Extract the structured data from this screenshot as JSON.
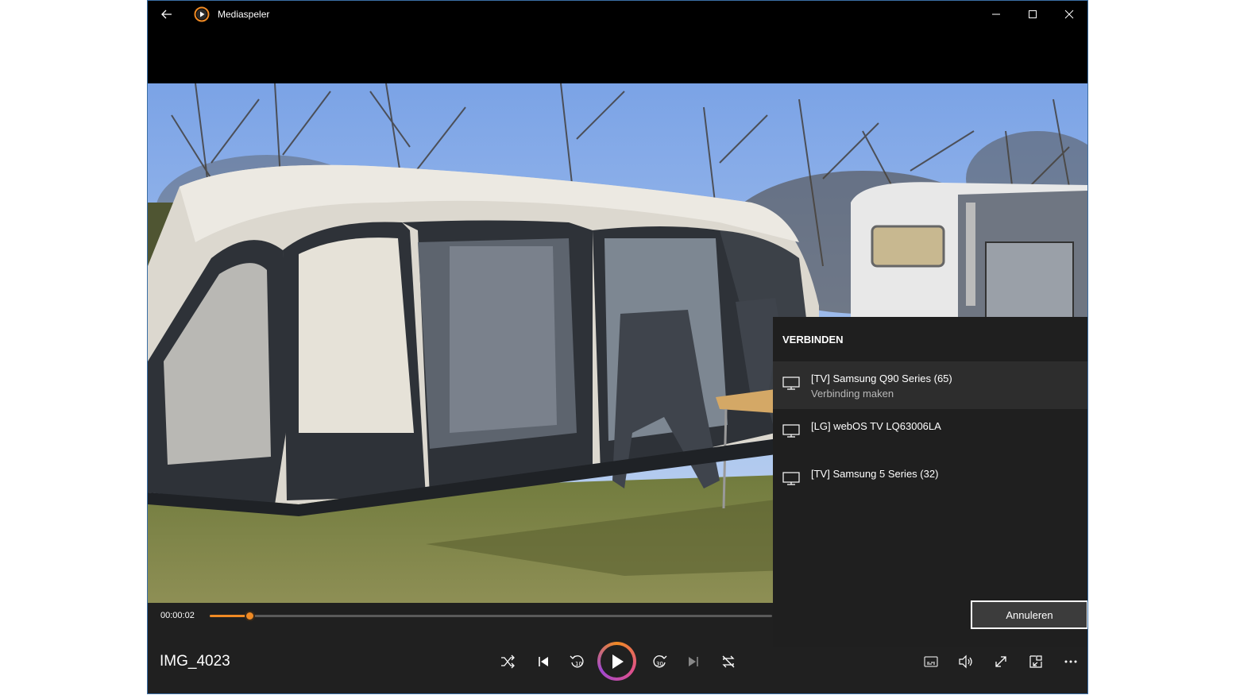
{
  "window": {
    "title": "Mediaspeler"
  },
  "icons": {
    "back": "back-arrow-icon",
    "app": "media-player-icon",
    "minimize": "minimize-icon",
    "maximize": "maximize-icon",
    "close": "close-icon"
  },
  "player": {
    "time_elapsed": "00:00:02",
    "progress_fraction": 0.07,
    "media_title": "IMG_4023",
    "accent": "#f08a24"
  },
  "connect_panel": {
    "title": "VERBINDEN",
    "devices": [
      {
        "name": "[TV] Samsung Q90 Series (65)",
        "status": "Verbinding maken",
        "icon": "monitor-icon"
      },
      {
        "name": "[LG] webOS TV LQ63006LA",
        "status": "",
        "icon": "monitor-icon"
      },
      {
        "name": "[TV] Samsung 5 Series (32)",
        "status": "",
        "icon": "monitor-icon"
      }
    ],
    "cancel_label": "Annuleren"
  },
  "control_icons": [
    "shuffle-icon",
    "previous-icon",
    "rewind-10-icon",
    "play-icon",
    "forward-30-icon",
    "next-icon",
    "repeat-icon",
    "subtitles-icon",
    "volume-icon",
    "fullscreen-icon",
    "mini-player-icon",
    "more-icon"
  ]
}
